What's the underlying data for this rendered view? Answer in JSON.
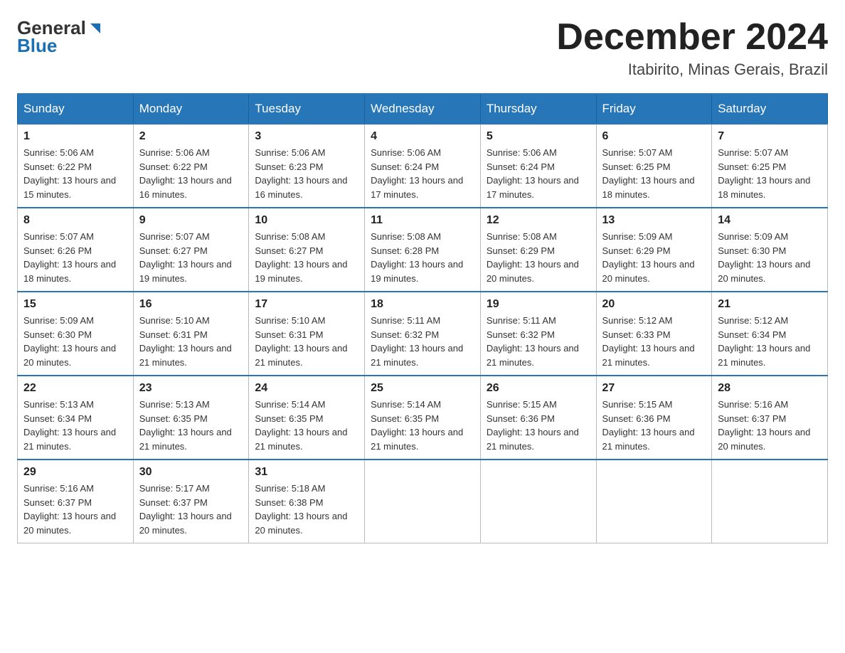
{
  "header": {
    "logo_general": "General",
    "logo_blue": "Blue",
    "month_title": "December 2024",
    "location": "Itabirito, Minas Gerais, Brazil"
  },
  "weekdays": [
    "Sunday",
    "Monday",
    "Tuesday",
    "Wednesday",
    "Thursday",
    "Friday",
    "Saturday"
  ],
  "weeks": [
    [
      {
        "day": "1",
        "sunrise": "Sunrise: 5:06 AM",
        "sunset": "Sunset: 6:22 PM",
        "daylight": "Daylight: 13 hours and 15 minutes."
      },
      {
        "day": "2",
        "sunrise": "Sunrise: 5:06 AM",
        "sunset": "Sunset: 6:22 PM",
        "daylight": "Daylight: 13 hours and 16 minutes."
      },
      {
        "day": "3",
        "sunrise": "Sunrise: 5:06 AM",
        "sunset": "Sunset: 6:23 PM",
        "daylight": "Daylight: 13 hours and 16 minutes."
      },
      {
        "day": "4",
        "sunrise": "Sunrise: 5:06 AM",
        "sunset": "Sunset: 6:24 PM",
        "daylight": "Daylight: 13 hours and 17 minutes."
      },
      {
        "day": "5",
        "sunrise": "Sunrise: 5:06 AM",
        "sunset": "Sunset: 6:24 PM",
        "daylight": "Daylight: 13 hours and 17 minutes."
      },
      {
        "day": "6",
        "sunrise": "Sunrise: 5:07 AM",
        "sunset": "Sunset: 6:25 PM",
        "daylight": "Daylight: 13 hours and 18 minutes."
      },
      {
        "day": "7",
        "sunrise": "Sunrise: 5:07 AM",
        "sunset": "Sunset: 6:25 PM",
        "daylight": "Daylight: 13 hours and 18 minutes."
      }
    ],
    [
      {
        "day": "8",
        "sunrise": "Sunrise: 5:07 AM",
        "sunset": "Sunset: 6:26 PM",
        "daylight": "Daylight: 13 hours and 18 minutes."
      },
      {
        "day": "9",
        "sunrise": "Sunrise: 5:07 AM",
        "sunset": "Sunset: 6:27 PM",
        "daylight": "Daylight: 13 hours and 19 minutes."
      },
      {
        "day": "10",
        "sunrise": "Sunrise: 5:08 AM",
        "sunset": "Sunset: 6:27 PM",
        "daylight": "Daylight: 13 hours and 19 minutes."
      },
      {
        "day": "11",
        "sunrise": "Sunrise: 5:08 AM",
        "sunset": "Sunset: 6:28 PM",
        "daylight": "Daylight: 13 hours and 19 minutes."
      },
      {
        "day": "12",
        "sunrise": "Sunrise: 5:08 AM",
        "sunset": "Sunset: 6:29 PM",
        "daylight": "Daylight: 13 hours and 20 minutes."
      },
      {
        "day": "13",
        "sunrise": "Sunrise: 5:09 AM",
        "sunset": "Sunset: 6:29 PM",
        "daylight": "Daylight: 13 hours and 20 minutes."
      },
      {
        "day": "14",
        "sunrise": "Sunrise: 5:09 AM",
        "sunset": "Sunset: 6:30 PM",
        "daylight": "Daylight: 13 hours and 20 minutes."
      }
    ],
    [
      {
        "day": "15",
        "sunrise": "Sunrise: 5:09 AM",
        "sunset": "Sunset: 6:30 PM",
        "daylight": "Daylight: 13 hours and 20 minutes."
      },
      {
        "day": "16",
        "sunrise": "Sunrise: 5:10 AM",
        "sunset": "Sunset: 6:31 PM",
        "daylight": "Daylight: 13 hours and 21 minutes."
      },
      {
        "day": "17",
        "sunrise": "Sunrise: 5:10 AM",
        "sunset": "Sunset: 6:31 PM",
        "daylight": "Daylight: 13 hours and 21 minutes."
      },
      {
        "day": "18",
        "sunrise": "Sunrise: 5:11 AM",
        "sunset": "Sunset: 6:32 PM",
        "daylight": "Daylight: 13 hours and 21 minutes."
      },
      {
        "day": "19",
        "sunrise": "Sunrise: 5:11 AM",
        "sunset": "Sunset: 6:32 PM",
        "daylight": "Daylight: 13 hours and 21 minutes."
      },
      {
        "day": "20",
        "sunrise": "Sunrise: 5:12 AM",
        "sunset": "Sunset: 6:33 PM",
        "daylight": "Daylight: 13 hours and 21 minutes."
      },
      {
        "day": "21",
        "sunrise": "Sunrise: 5:12 AM",
        "sunset": "Sunset: 6:34 PM",
        "daylight": "Daylight: 13 hours and 21 minutes."
      }
    ],
    [
      {
        "day": "22",
        "sunrise": "Sunrise: 5:13 AM",
        "sunset": "Sunset: 6:34 PM",
        "daylight": "Daylight: 13 hours and 21 minutes."
      },
      {
        "day": "23",
        "sunrise": "Sunrise: 5:13 AM",
        "sunset": "Sunset: 6:35 PM",
        "daylight": "Daylight: 13 hours and 21 minutes."
      },
      {
        "day": "24",
        "sunrise": "Sunrise: 5:14 AM",
        "sunset": "Sunset: 6:35 PM",
        "daylight": "Daylight: 13 hours and 21 minutes."
      },
      {
        "day": "25",
        "sunrise": "Sunrise: 5:14 AM",
        "sunset": "Sunset: 6:35 PM",
        "daylight": "Daylight: 13 hours and 21 minutes."
      },
      {
        "day": "26",
        "sunrise": "Sunrise: 5:15 AM",
        "sunset": "Sunset: 6:36 PM",
        "daylight": "Daylight: 13 hours and 21 minutes."
      },
      {
        "day": "27",
        "sunrise": "Sunrise: 5:15 AM",
        "sunset": "Sunset: 6:36 PM",
        "daylight": "Daylight: 13 hours and 21 minutes."
      },
      {
        "day": "28",
        "sunrise": "Sunrise: 5:16 AM",
        "sunset": "Sunset: 6:37 PM",
        "daylight": "Daylight: 13 hours and 20 minutes."
      }
    ],
    [
      {
        "day": "29",
        "sunrise": "Sunrise: 5:16 AM",
        "sunset": "Sunset: 6:37 PM",
        "daylight": "Daylight: 13 hours and 20 minutes."
      },
      {
        "day": "30",
        "sunrise": "Sunrise: 5:17 AM",
        "sunset": "Sunset: 6:37 PM",
        "daylight": "Daylight: 13 hours and 20 minutes."
      },
      {
        "day": "31",
        "sunrise": "Sunrise: 5:18 AM",
        "sunset": "Sunset: 6:38 PM",
        "daylight": "Daylight: 13 hours and 20 minutes."
      },
      null,
      null,
      null,
      null
    ]
  ]
}
